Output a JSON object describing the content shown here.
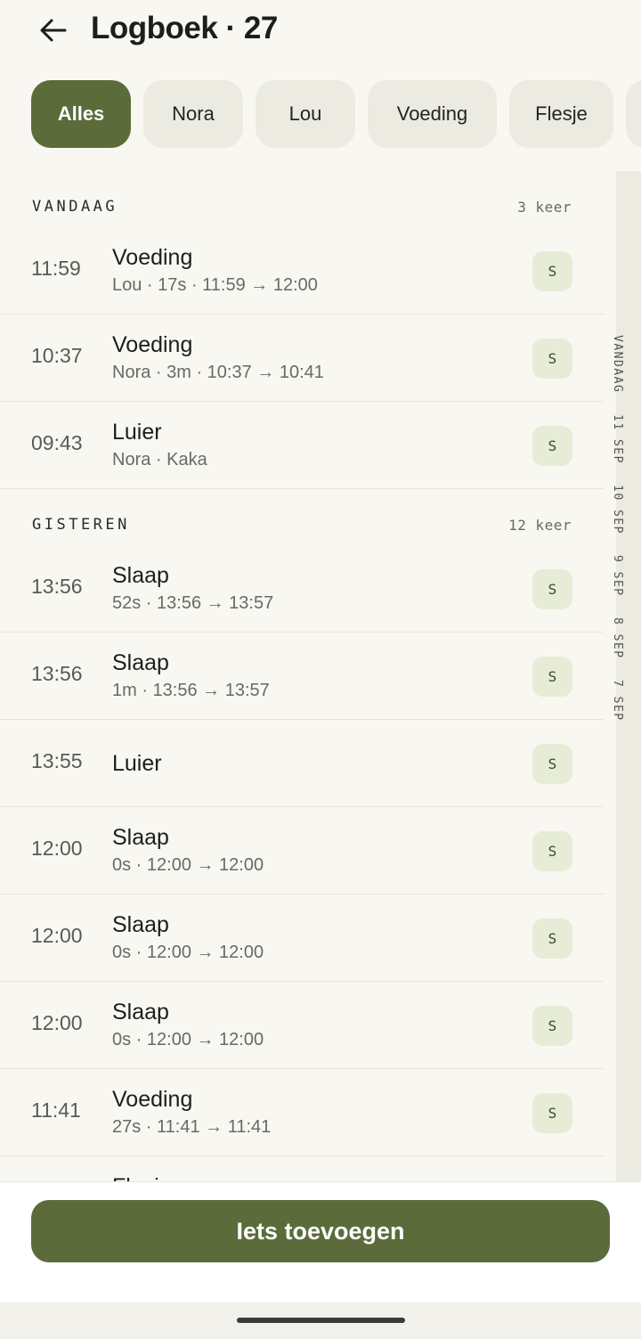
{
  "header": {
    "title": "Logboek · 27",
    "back_icon": "arrow-left-icon"
  },
  "filters": [
    "Alles",
    "Nora",
    "Lou",
    "Voeding",
    "Flesje",
    ""
  ],
  "rail": [
    "VANDAAG",
    "11 SEP",
    "10 SEP",
    "9 SEP",
    "8 SEP",
    "7 SEP"
  ],
  "sections": [
    {
      "title": "VANDAAG",
      "count": "3 keer",
      "rows": [
        {
          "time": "11:59",
          "title": "Voeding",
          "sub": "Lou · 17s · 11:59 → 12:00",
          "badge": "S"
        },
        {
          "time": "10:37",
          "title": "Voeding",
          "sub": "Nora · 3m · 10:37 → 10:41",
          "badge": "S"
        },
        {
          "time": "09:43",
          "title": "Luier",
          "sub": "Nora · Kaka",
          "badge": "S"
        }
      ]
    },
    {
      "title": "GISTEREN",
      "count": "12 keer",
      "rows": [
        {
          "time": "13:56",
          "title": "Slaap",
          "sub": "52s · 13:56 → 13:57",
          "badge": "S"
        },
        {
          "time": "13:56",
          "title": "Slaap",
          "sub": "1m · 13:56 → 13:57",
          "badge": "S"
        },
        {
          "time": "13:55",
          "title": "Luier",
          "sub": "",
          "badge": "S"
        },
        {
          "time": "12:00",
          "title": "Slaap",
          "sub": "0s · 12:00 → 12:00",
          "badge": "S"
        },
        {
          "time": "12:00",
          "title": "Slaap",
          "sub": "0s · 12:00 → 12:00",
          "badge": "S"
        },
        {
          "time": "12:00",
          "title": "Slaap",
          "sub": "0s · 12:00 → 12:00",
          "badge": "S"
        },
        {
          "time": "11:41",
          "title": "Voeding",
          "sub": "27s · 11:41 → 11:41",
          "badge": "S"
        }
      ]
    }
  ],
  "peek_title": "Flesje",
  "add_button": "Iets toevoegen",
  "colors": {
    "accent": "#5b6b3a",
    "chip": "#ecebe1",
    "badge": "#e7ecd7",
    "background": "#f8f7f2"
  }
}
